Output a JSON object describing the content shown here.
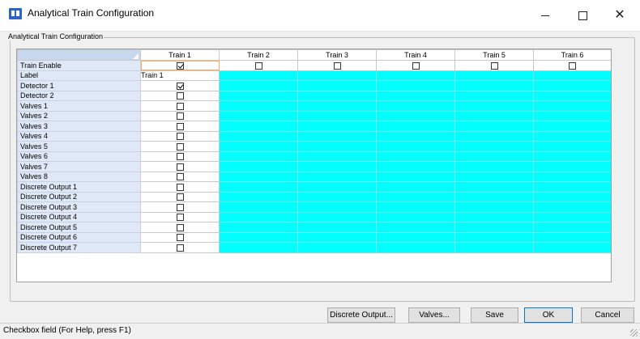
{
  "window": {
    "title": "Analytical Train Configuration"
  },
  "group": {
    "legend": "Analytical Train Configuration"
  },
  "columns": [
    "Train 1",
    "Train 2",
    "Train 3",
    "Train 4",
    "Train 5",
    "Train 6"
  ],
  "train_enable": {
    "label": "Train Enable",
    "checked": [
      true,
      false,
      false,
      false,
      false,
      false
    ]
  },
  "label_row": {
    "label": "Label",
    "value": "Train 1"
  },
  "rows_a": [
    {
      "label": "Detector 1",
      "checked": true
    },
    {
      "label": "Detector 2",
      "checked": false
    },
    {
      "label": "Valves 1",
      "checked": false
    },
    {
      "label": "Valves 2",
      "checked": false
    },
    {
      "label": "Valves 3",
      "checked": false
    },
    {
      "label": "Valves 4",
      "checked": false
    },
    {
      "label": "Valves 5",
      "checked": false
    },
    {
      "label": "Valves 6",
      "checked": false
    },
    {
      "label": "Valves 7",
      "checked": false
    },
    {
      "label": "Valves 8",
      "checked": false
    }
  ],
  "rows_b": [
    {
      "label": "Discrete Output 1",
      "checked": false
    },
    {
      "label": "Discrete Output 2",
      "checked": false
    },
    {
      "label": "Discrete Output 3",
      "checked": false
    },
    {
      "label": "Discrete Output 4",
      "checked": false
    },
    {
      "label": "Discrete Output 5",
      "checked": false
    },
    {
      "label": "Discrete Output 6",
      "checked": false
    },
    {
      "label": "Discrete Output 7",
      "checked": false
    }
  ],
  "buttons": {
    "discrete_output": "Discrete Output...",
    "valves": "Valves...",
    "save": "Save",
    "ok": "OK",
    "cancel": "Cancel"
  },
  "status": {
    "text": "Checkbox field (For Help, press F1)"
  },
  "colors": {
    "disabled_cell": "#00ffff",
    "row_header": "#dfe8f6"
  }
}
